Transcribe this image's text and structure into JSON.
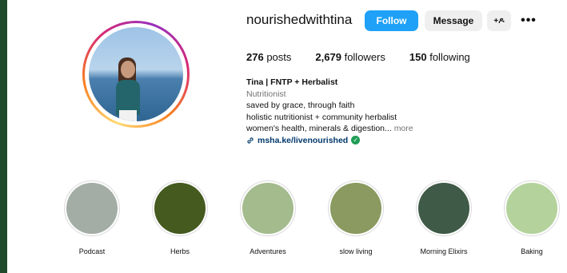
{
  "profile": {
    "username": "nourishedwithtina",
    "follow_label": "Follow",
    "message_label": "Message",
    "add_user_icon": "+ዶ",
    "more_icon": "•••",
    "posts_count": "276",
    "posts_label": "posts",
    "followers_count": "2,679",
    "followers_label": "followers",
    "following_count": "150",
    "following_label": "following"
  },
  "bio": {
    "name": "Tina | FNTP + Herbalist",
    "category": "Nutritionist",
    "line1": "saved by grace, through faith",
    "line2": "holistic nutritionist + community herbalist",
    "line3": "women's health, minerals & digestion...",
    "more_label": "more",
    "link_icon": "link-icon",
    "link_text": "msha.ke/livenourished",
    "verified_icon": "✓"
  },
  "highlights": [
    {
      "label": "Podcast",
      "color": "#a3ada5"
    },
    {
      "label": "Herbs",
      "color": "#445a1f"
    },
    {
      "label": "Adventures",
      "color": "#a3bb8d"
    },
    {
      "label": "slow living",
      "color": "#8a9a60"
    },
    {
      "label": "Morning Elixirs",
      "color": "#3f5a47"
    },
    {
      "label": "Baking",
      "color": "#b4d39c"
    }
  ],
  "colors": {
    "follow": "#1ea1f7",
    "background_border": "#1f4a2c",
    "verified": "#1f9d55"
  }
}
